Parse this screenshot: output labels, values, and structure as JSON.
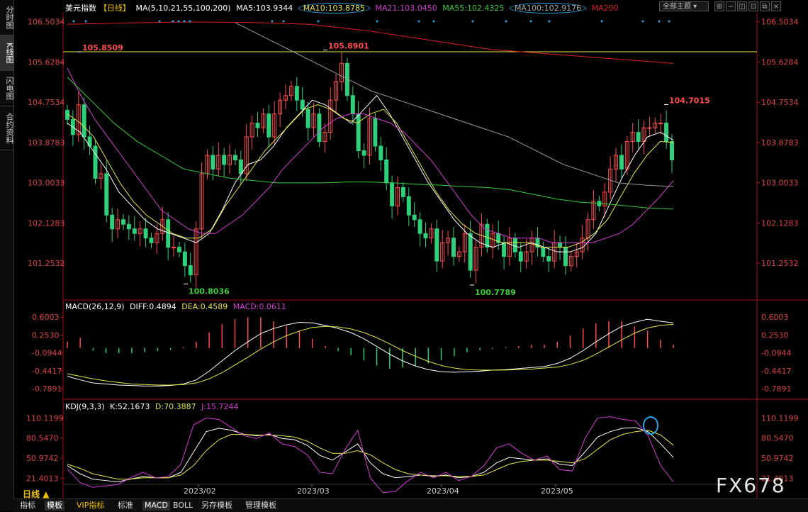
{
  "left_tabs": [
    "分时图",
    "K线图",
    "闪电图",
    "合约资料"
  ],
  "header": {
    "instrument": "美元指数",
    "period_tag": "【日线】",
    "ma_params": "MA(5,10,21,55,100,200)",
    "ma5": "MA5:103.9344",
    "ma10": "MA10:103.8785",
    "ma21": "MA21:103.0450",
    "ma55": "MA55:102.4325",
    "ma100": "MA100:102.9176",
    "ma200": "MA200",
    "dropdown": "全部主题"
  },
  "macd_header": {
    "name": "MACD(26,12,9)",
    "diff": "DIFF:0.4894",
    "dea": "DEA:0.4589",
    "macd": "MACD:0.0611"
  },
  "kdj_header": {
    "name": "KDJ(9,3,3)",
    "k": "K:52.1673",
    "d": "D:70.3887",
    "j": "J:15.7244"
  },
  "bottom_tabs": [
    "指标",
    "模板",
    "VIP指标",
    "标准",
    "MACD",
    "BOLL",
    "另存模板",
    "管理模板"
  ],
  "period_label": "日线",
  "watermark": "FX678",
  "colors": {
    "up": "#ff4d4d",
    "down": "#2fd07a",
    "ma5": "#ffffff",
    "ma10": "#e6e64a",
    "ma21": "#d43cd4",
    "ma55": "#3ccc3c",
    "ma100": "#999999",
    "ma200": "#e02020",
    "axis": "#b01010"
  },
  "chart_data": [
    {
      "type": "candlestick",
      "x": [
        "2023/02",
        "2023/03",
        "2023/04",
        "2023/05"
      ],
      "y_ticks": [
        106.5034,
        105.6284,
        104.7534,
        103.8783,
        103.0033,
        102.1283,
        101.2532
      ],
      "ylim": [
        100.5,
        106.7
      ],
      "annotations": [
        {
          "label": "105.8509",
          "value": 105.8509
        },
        {
          "label": "105.8901",
          "value": 105.8901
        },
        {
          "label": "104.7015",
          "value": 104.7015
        },
        {
          "label": "100.8036",
          "value": 100.8036
        },
        {
          "label": "100.7789",
          "value": 100.7789
        }
      ],
      "reference_line": 105.8509,
      "close": [
        104.38,
        104.05,
        104.7,
        104.0,
        103.8,
        103.1,
        103.2,
        102.3,
        102.0,
        102.2,
        102.1,
        102.0,
        101.9,
        102.0,
        101.8,
        101.7,
        101.9,
        102.2,
        101.6,
        101.6,
        101.5,
        101.2,
        101.0,
        102.0,
        103.2,
        103.6,
        103.3,
        103.6,
        103.4,
        103.6,
        103.5,
        103.2,
        104.0,
        104.3,
        104.2,
        104.5,
        104.0,
        104.5,
        104.8,
        104.9,
        105.1,
        104.8,
        104.6,
        104.2,
        104.5,
        103.9,
        104.1,
        104.8,
        105.2,
        105.6,
        104.9,
        104.5,
        103.7,
        103.6,
        104.4,
        103.8,
        103.5,
        103.0,
        102.5,
        102.9,
        102.7,
        102.3,
        102.2,
        101.9,
        101.8,
        102.0,
        101.3,
        101.7,
        101.8,
        101.4,
        101.5,
        101.9,
        101.1,
        101.6,
        102.1,
        101.6,
        101.9,
        101.7,
        101.4,
        101.8,
        101.5,
        101.3,
        101.5,
        101.8,
        101.6,
        101.4,
        101.3,
        101.7,
        101.6,
        101.2,
        101.4,
        101.5,
        101.8,
        102.2,
        102.6,
        102.5,
        102.8,
        103.3,
        103.6,
        103.3,
        103.9,
        104.1,
        103.9,
        104.2,
        104.2,
        104.3,
        104.3,
        103.9,
        103.5
      ],
      "series": [
        {
          "name": "MA5",
          "values": [
            104.3,
            104.1,
            103.7,
            103.3,
            102.8,
            102.5,
            102.2,
            102.0,
            101.9,
            101.8,
            101.7,
            101.9,
            102.4,
            103.0,
            103.4,
            103.5,
            103.8,
            104.2,
            104.5,
            104.8,
            104.7,
            104.5,
            104.3,
            104.6,
            104.9,
            104.5,
            104.0,
            103.5,
            103.0,
            102.6,
            102.2,
            101.9,
            101.7,
            101.6,
            101.7,
            101.6,
            101.7,
            101.6,
            101.5,
            101.5,
            101.6,
            101.9,
            102.5,
            103.1,
            103.6,
            104.0,
            104.1,
            103.93
          ]
        },
        {
          "name": "MA10",
          "values": [
            104.5,
            104.3,
            104.0,
            103.5,
            103.0,
            102.6,
            102.3,
            102.1,
            101.9,
            101.8,
            101.8,
            102.0,
            102.5,
            102.9,
            103.3,
            103.7,
            104.0,
            104.3,
            104.6,
            104.7,
            104.6,
            104.4,
            104.3,
            104.5,
            104.6,
            104.3,
            103.8,
            103.3,
            102.8,
            102.4,
            102.1,
            101.9,
            101.8,
            101.7,
            101.7,
            101.7,
            101.6,
            101.6,
            101.6,
            101.7,
            101.9,
            102.2,
            102.7,
            103.2,
            103.6,
            103.9,
            103.88
          ]
        },
        {
          "name": "MA21",
          "values": [
            105.5,
            104.9,
            104.4,
            104.0,
            103.6,
            103.2,
            102.8,
            102.4,
            102.2,
            102.0,
            101.9,
            101.9,
            102.1,
            102.3,
            102.6,
            102.9,
            103.3,
            103.6,
            103.9,
            104.2,
            104.4,
            104.5,
            104.5,
            104.4,
            104.3,
            104.1,
            103.8,
            103.5,
            103.1,
            102.7,
            102.3,
            102.0,
            101.9,
            101.8,
            101.8,
            101.8,
            101.7,
            101.7,
            101.7,
            101.7,
            101.8,
            101.9,
            102.1,
            102.4,
            102.7,
            103.05
          ]
        },
        {
          "name": "MA55",
          "values": [
            105.3,
            104.8,
            104.3,
            103.9,
            103.6,
            103.3,
            103.2,
            103.1,
            103.05,
            103.0,
            103.0,
            103.0,
            103.02,
            103.02,
            103.0,
            102.97,
            102.95,
            102.92,
            102.9,
            102.85,
            102.75,
            102.65,
            102.58,
            102.55,
            102.5,
            102.45,
            102.43
          ]
        },
        {
          "name": "MA100",
          "values": [
            106.5,
            106.2,
            105.9,
            105.6,
            105.3,
            105.0,
            104.8,
            104.6,
            104.4,
            104.2,
            104.0,
            103.7,
            103.4,
            103.2,
            103.0,
            102.95,
            102.92
          ]
        },
        {
          "name": "MA200",
          "values": [
            106.45,
            106.48,
            106.5,
            106.49,
            106.45,
            106.3,
            106.1,
            105.9,
            105.8,
            105.7,
            105.6
          ]
        }
      ]
    },
    {
      "type": "bar",
      "title": "MACD(26,12,9)",
      "y_ticks": [
        0.6003,
        0.253,
        -0.0944,
        -0.4417,
        -0.7891
      ],
      "ylim": [
        -0.9,
        0.7
      ],
      "series": [
        {
          "name": "DIFF",
          "values": [
            -0.55,
            -0.62,
            -0.68,
            -0.7,
            -0.72,
            -0.73,
            -0.74,
            -0.74,
            -0.73,
            -0.7,
            -0.62,
            -0.45,
            -0.25,
            -0.05,
            0.12,
            0.28,
            0.38,
            0.45,
            0.5,
            0.49,
            0.44,
            0.38,
            0.3,
            0.18,
            0.03,
            -0.12,
            -0.25,
            -0.35,
            -0.42,
            -0.46,
            -0.47,
            -0.46,
            -0.45,
            -0.43,
            -0.42,
            -0.4,
            -0.38,
            -0.36,
            -0.3,
            -0.2,
            -0.05,
            0.12,
            0.28,
            0.42,
            0.5,
            0.56,
            0.52,
            0.49
          ]
        },
        {
          "name": "DEA",
          "values": [
            -0.5,
            -0.55,
            -0.6,
            -0.64,
            -0.67,
            -0.7,
            -0.71,
            -0.72,
            -0.72,
            -0.71,
            -0.68,
            -0.6,
            -0.48,
            -0.33,
            -0.18,
            -0.02,
            0.12,
            0.24,
            0.33,
            0.4,
            0.42,
            0.41,
            0.37,
            0.3,
            0.2,
            0.08,
            -0.05,
            -0.16,
            -0.26,
            -0.34,
            -0.39,
            -0.42,
            -0.43,
            -0.43,
            -0.43,
            -0.42,
            -0.41,
            -0.39,
            -0.37,
            -0.32,
            -0.24,
            -0.12,
            0.02,
            0.16,
            0.29,
            0.39,
            0.44,
            0.46
          ]
        },
        {
          "name": "MACD",
          "values": [
            0.12,
            0.2,
            -0.05,
            -0.1,
            -0.1,
            -0.1,
            -0.08,
            -0.06,
            -0.04,
            0.02,
            0.12,
            0.3,
            0.46,
            0.56,
            0.6,
            0.6,
            0.52,
            0.42,
            0.34,
            0.18,
            0.04,
            -0.06,
            -0.14,
            -0.24,
            -0.34,
            -0.4,
            -0.38,
            -0.34,
            -0.3,
            -0.24,
            -0.16,
            -0.08,
            -0.04,
            -0.02,
            0.02,
            0.04,
            0.06,
            0.06,
            0.12,
            0.24,
            0.38,
            0.48,
            0.52,
            0.52,
            0.42,
            0.34,
            0.16,
            0.06
          ]
        }
      ]
    },
    {
      "type": "line",
      "title": "KDJ(9,3,3)",
      "y_ticks": [
        110.1199,
        80.547,
        50.9742,
        21.4013
      ],
      "ylim": [
        5,
        120
      ],
      "series": [
        {
          "name": "K",
          "values": [
            40,
            28,
            20,
            18,
            16,
            20,
            24,
            22,
            22,
            30,
            60,
            90,
            95,
            92,
            86,
            84,
            86,
            80,
            78,
            70,
            55,
            48,
            60,
            72,
            44,
            28,
            22,
            24,
            26,
            24,
            26,
            22,
            24,
            30,
            44,
            52,
            50,
            48,
            50,
            42,
            40,
            60,
            82,
            90,
            95,
            96,
            90,
            72,
            52
          ]
        },
        {
          "name": "D",
          "values": [
            42,
            36,
            28,
            24,
            20,
            20,
            22,
            22,
            22,
            26,
            40,
            62,
            78,
            86,
            86,
            85,
            85,
            84,
            82,
            76,
            66,
            58,
            58,
            62,
            56,
            44,
            34,
            28,
            26,
            25,
            25,
            24,
            24,
            26,
            34,
            42,
            46,
            48,
            48,
            46,
            44,
            50,
            64,
            78,
            86,
            90,
            92,
            85,
            70
          ]
        },
        {
          "name": "J",
          "values": [
            35,
            15,
            8,
            10,
            12,
            22,
            30,
            22,
            24,
            42,
            100,
            110,
            108,
            96,
            84,
            80,
            88,
            72,
            68,
            56,
            30,
            28,
            64,
            92,
            22,
            0,
            2,
            18,
            30,
            22,
            30,
            18,
            24,
            40,
            66,
            72,
            58,
            48,
            54,
            34,
            32,
            80,
            110,
            112,
            108,
            106,
            84,
            40,
            16
          ]
        }
      ]
    }
  ]
}
